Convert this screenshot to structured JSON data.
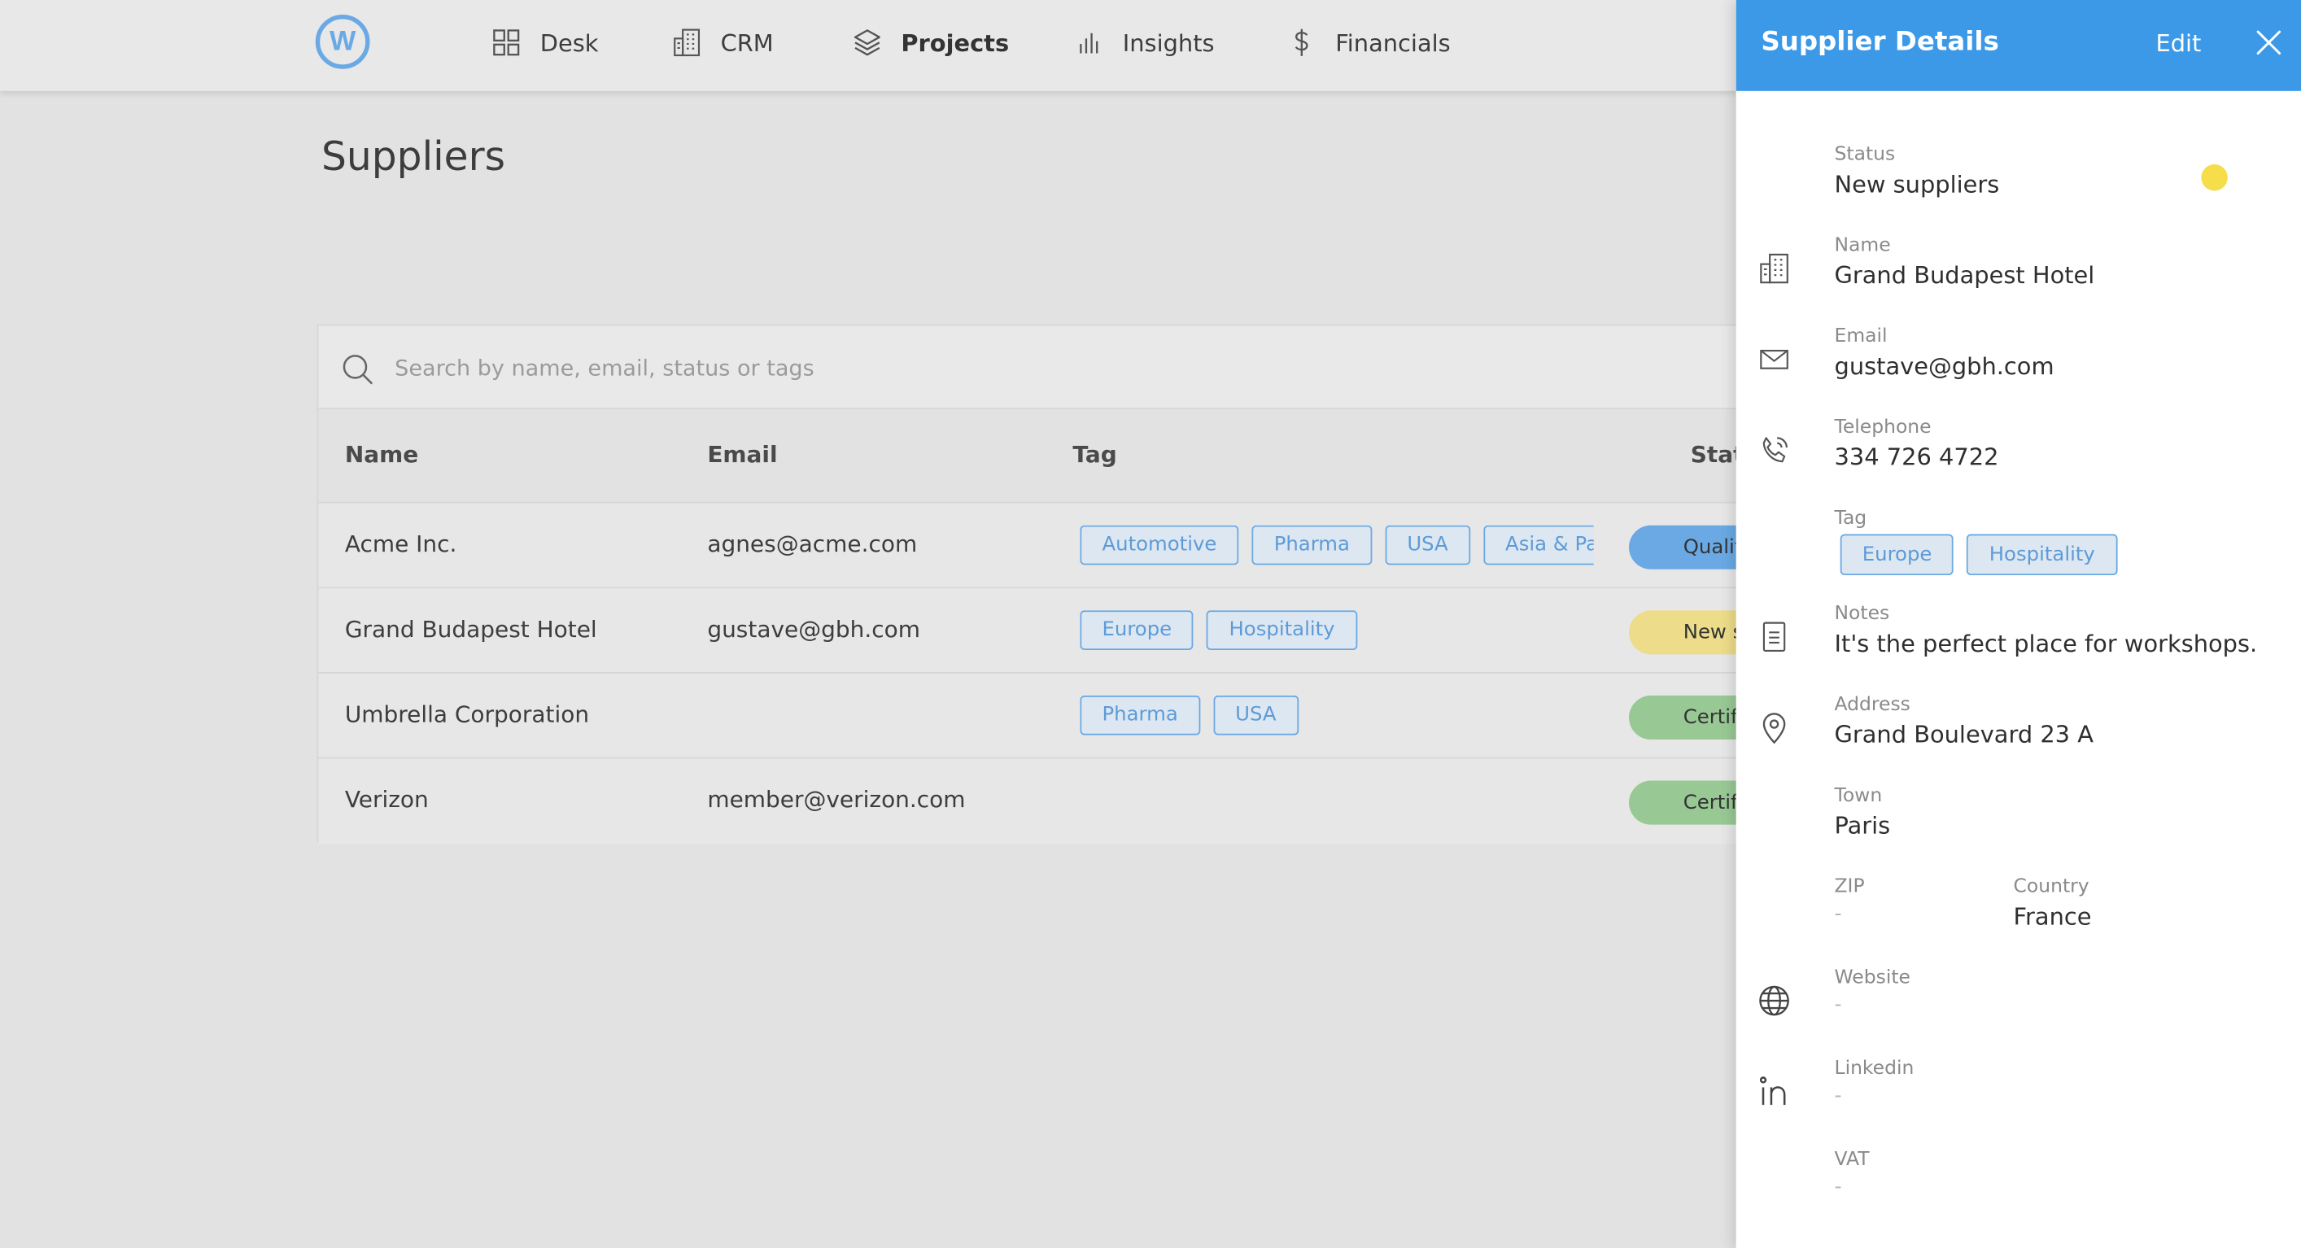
{
  "nav": {
    "logo_letter": "W",
    "items": [
      {
        "label": "Desk",
        "icon": "grid-icon",
        "active": false
      },
      {
        "label": "CRM",
        "icon": "building-icon",
        "active": false
      },
      {
        "label": "Projects",
        "icon": "layers-icon",
        "active": true
      },
      {
        "label": "Insights",
        "icon": "bar-chart-icon",
        "active": false
      },
      {
        "label": "Financials",
        "icon": "dollar-icon",
        "active": false
      }
    ]
  },
  "page": {
    "title": "Suppliers"
  },
  "search": {
    "placeholder": "Search by name, email, status or tags",
    "value": ""
  },
  "table": {
    "headers": {
      "name": "Name",
      "email": "Email",
      "tag": "Tag",
      "status": "Status"
    },
    "rows": [
      {
        "name": "Acme Inc.",
        "email": "agnes@acme.com",
        "tags": [
          "Automotive",
          "Pharma",
          "USA",
          "Asia & Pacific"
        ],
        "status": "Qualified",
        "status_color": "#6aa9e4"
      },
      {
        "name": "Grand Budapest Hotel",
        "email": "gustave@gbh.com",
        "tags": [
          "Europe",
          "Hospitality"
        ],
        "status": "New suppliers",
        "status_color": "#eddd8a"
      },
      {
        "name": "Umbrella Corporation",
        "email": "",
        "tags": [
          "Pharma",
          "USA"
        ],
        "status": "Certified",
        "status_color": "#98c995"
      },
      {
        "name": "Verizon",
        "email": "member@verizon.com",
        "tags": [],
        "status": "Certified",
        "status_color": "#98c995"
      }
    ]
  },
  "drawer": {
    "title": "Supplier Details",
    "edit_label": "Edit",
    "status": {
      "label": "Status",
      "value": "New suppliers",
      "dot_color": "#f6de4b"
    },
    "name": {
      "label": "Name",
      "value": "Grand Budapest Hotel"
    },
    "email": {
      "label": "Email",
      "value": "gustave@gbh.com"
    },
    "telephone": {
      "label": "Telephone",
      "value": "334 726 4722"
    },
    "tag": {
      "label": "Tag",
      "values": [
        "Europe",
        "Hospitality"
      ]
    },
    "notes": {
      "label": "Notes",
      "value": "It's the perfect place for workshops."
    },
    "address": {
      "label": "Address",
      "value": "Grand Boulevard 23 A"
    },
    "town": {
      "label": "Town",
      "value": "Paris"
    },
    "zip": {
      "label": "ZIP",
      "value": "-"
    },
    "country": {
      "label": "Country",
      "value": "France"
    },
    "website": {
      "label": "Website",
      "value": "-"
    },
    "linkedin": {
      "label": "Linkedin",
      "value": "-"
    },
    "vat": {
      "label": "VAT",
      "value": "-"
    }
  },
  "colors": {
    "accent": "#3b99e8",
    "tag_border": "#6aa9e4",
    "tag_text": "#5d9bd8",
    "background": "#e2e2e3"
  }
}
